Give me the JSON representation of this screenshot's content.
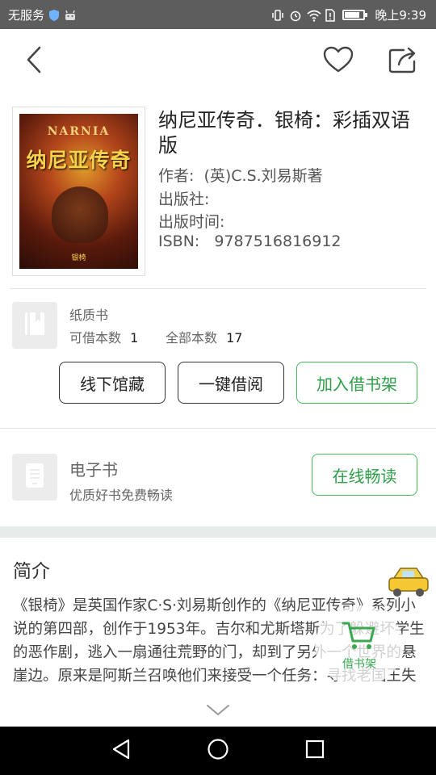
{
  "status_bar": {
    "carrier": "无服务",
    "time": "晚上9:39"
  },
  "header": {
    "back_icon": "chevron-left-icon",
    "favorite_icon": "heart-icon",
    "share_icon": "share-icon"
  },
  "book": {
    "cover_series": "NARNIA",
    "cover_title": "纳尼亚传奇",
    "cover_subtitle": "银椅",
    "title": "纳尼亚传奇．银椅：彩插双语版",
    "author_label": "作者:",
    "author": "(英)C.S.刘易斯著",
    "publisher_label": "出版社:",
    "publisher": "",
    "pubdate_label": "出版时间:",
    "pubdate": "",
    "isbn_label": "ISBN:",
    "isbn": "9787516816912"
  },
  "paper_book": {
    "label": "纸质书",
    "available_label": "可借本数",
    "available_count": "1",
    "total_label": "全部本数",
    "total_count": "17",
    "buttons": {
      "offline": "线下馆藏",
      "borrow": "一键借阅",
      "add_shelf": "加入借书架"
    }
  },
  "ebook": {
    "label": "电子书",
    "desc": "优质好书免费畅读",
    "read_online": "在线畅读"
  },
  "intro": {
    "title": "简介",
    "text": "《银椅》是英国作家C·S·刘易斯创作的《纳尼亚传奇》系列小说的第四部，创作于1953年。吉尔和尤斯塔斯为了躲避坏学生的恶作剧，逃入一扇通往荒野的门，却到了另外一个世界的悬崖边。原来是阿斯兰召唤他们来接受一个任务：寻找老国王失踪已久的王子。随后吉尔"
  },
  "floating": {
    "cart_label": "借书架"
  },
  "colors": {
    "accent_green": "#43b85d",
    "status_bar": "#5d5d5d"
  }
}
